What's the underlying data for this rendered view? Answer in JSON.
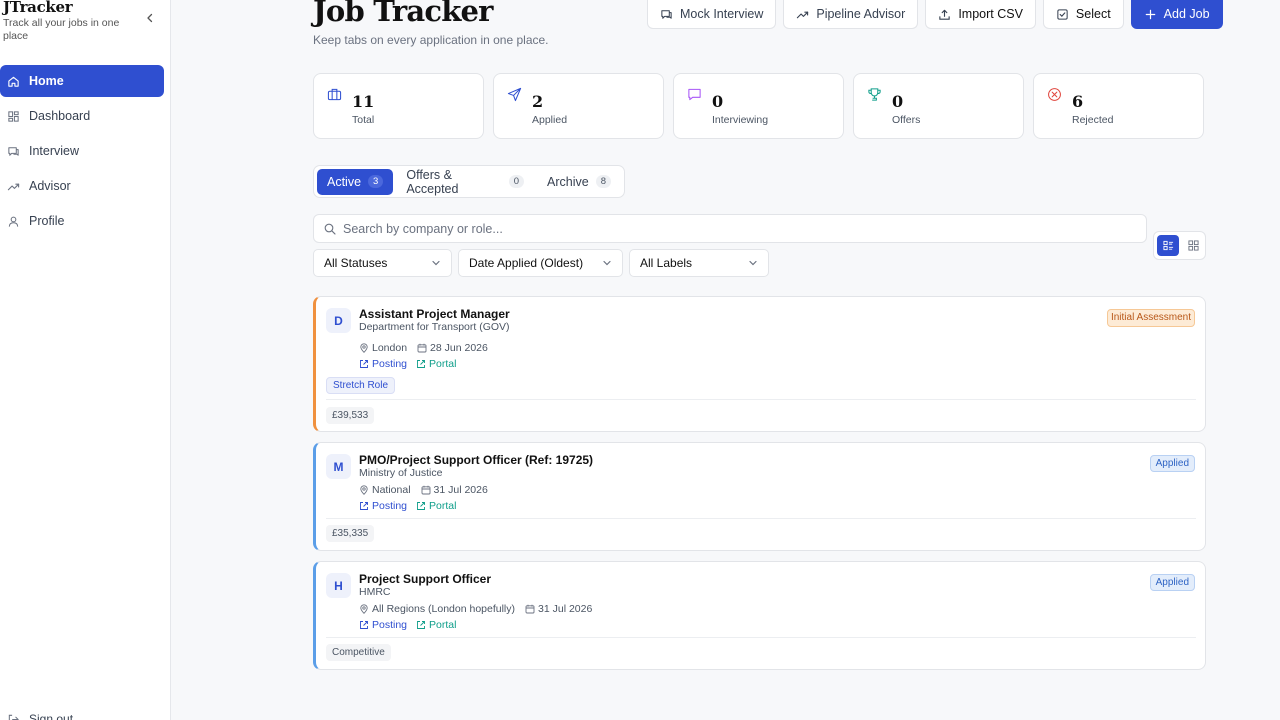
{
  "app": {
    "brand": "JTracker",
    "tagline": "Track all your jobs in one place"
  },
  "sidebar": {
    "items": [
      {
        "label": "Home",
        "icon": "home-icon",
        "active": true
      },
      {
        "label": "Dashboard",
        "icon": "dashboard-icon",
        "active": false
      },
      {
        "label": "Interview",
        "icon": "interview-icon",
        "active": false
      },
      {
        "label": "Advisor",
        "icon": "trending-icon",
        "active": false
      },
      {
        "label": "Profile",
        "icon": "user-icon",
        "active": false
      }
    ],
    "signout_label": "Sign out"
  },
  "header": {
    "title": "Job Tracker",
    "subtitle": "Keep tabs on every application in one place."
  },
  "toolbar": {
    "mock_interview": "Mock Interview",
    "pipeline_advisor": "Pipeline Advisor",
    "import_csv": "Import CSV",
    "select": "Select",
    "add_job": "Add Job"
  },
  "stats": [
    {
      "value": "11",
      "label": "Total",
      "icon": "briefcase-icon",
      "color": "#2f4fd0"
    },
    {
      "value": "2",
      "label": "Applied",
      "icon": "send-icon",
      "color": "#2f4fd0"
    },
    {
      "value": "0",
      "label": "Interviewing",
      "icon": "chat-icon",
      "color": "#a855f7"
    },
    {
      "value": "0",
      "label": "Offers",
      "icon": "trophy-icon",
      "color": "#0f9e8a"
    },
    {
      "value": "6",
      "label": "Rejected",
      "icon": "x-circle-icon",
      "color": "#e0463e"
    }
  ],
  "tabs": [
    {
      "label": "Active",
      "count": "3",
      "active": true
    },
    {
      "label": "Offers & Accepted",
      "count": "0",
      "active": false
    },
    {
      "label": "Archive",
      "count": "8",
      "active": false
    }
  ],
  "search": {
    "placeholder": "Search by company or role...",
    "value": ""
  },
  "filters": {
    "status": "All Statuses",
    "sort": "Date Applied (Oldest)",
    "labels": "All Labels"
  },
  "jobs": [
    {
      "initial": "D",
      "role": "Assistant Project Manager",
      "company": "Department for Transport (GOV)",
      "location": "London",
      "date": "28 Jun 2026",
      "posting": "Posting",
      "portal": "Portal",
      "label": "Stretch Role",
      "salary": "£39,533",
      "status": "Initial Assessment",
      "accent": "#f0913f"
    },
    {
      "initial": "M",
      "role": "PMO/Project Support Officer (Ref: 19725)",
      "company": "Ministry of Justice",
      "location": "National",
      "date": "31 Jul 2026",
      "posting": "Posting",
      "portal": "Portal",
      "salary": "£35,335",
      "status": "Applied",
      "accent": "#5b9ee8"
    },
    {
      "initial": "H",
      "role": "Project Support Officer",
      "company": "HMRC",
      "location": "All Regions (London hopefully)",
      "date": "31 Jul 2026",
      "posting": "Posting",
      "portal": "Portal",
      "salary": "Competitive",
      "status": "Applied",
      "accent": "#5b9ee8"
    }
  ]
}
